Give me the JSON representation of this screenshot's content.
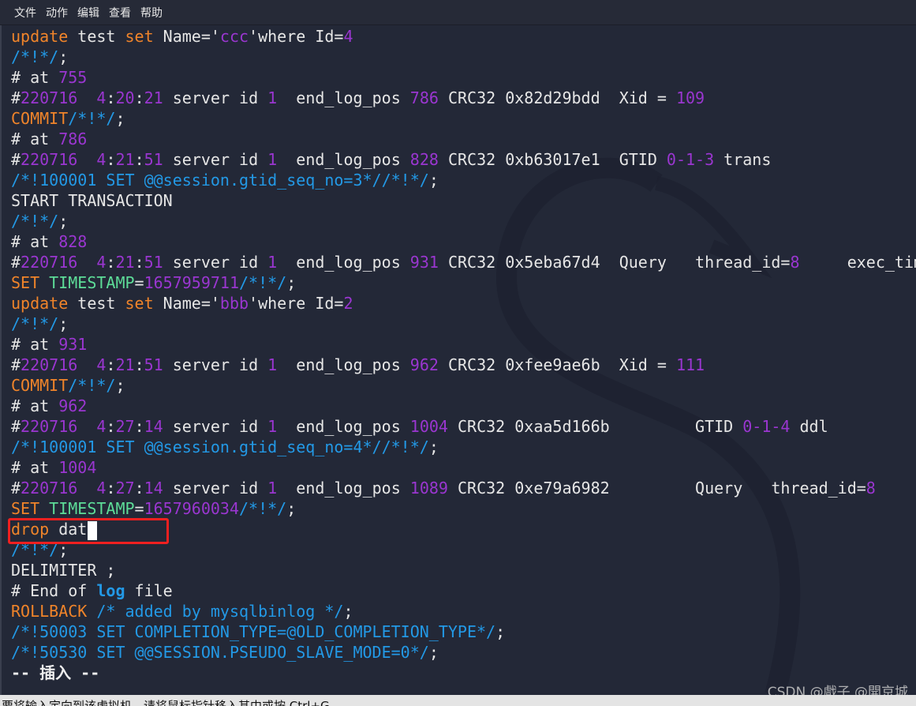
{
  "menu": [
    "文件",
    "动作",
    "编辑",
    "查看",
    "帮助"
  ],
  "colors": {
    "background": "#232837",
    "text": "#e6e6e6",
    "keyword": "#f0842a",
    "number": "#9a36d0",
    "comment": "#2399e6",
    "identifier": "#5ddc98",
    "highlight_box": "#f02020"
  },
  "terminal": {
    "lines": [
      [
        [
          "update",
          "o"
        ],
        [
          " test ",
          "w"
        ],
        [
          "set",
          "o"
        ],
        [
          " Name='",
          "w"
        ],
        [
          "ccc",
          "p"
        ],
        [
          "'where Id=",
          "w"
        ],
        [
          "4",
          "p"
        ]
      ],
      [
        [
          "/*!*/",
          "b"
        ],
        [
          ";",
          "w"
        ]
      ],
      [
        [
          "# at ",
          "w"
        ],
        [
          "755",
          "p"
        ]
      ],
      [
        [
          "#",
          "w"
        ],
        [
          "220716",
          "p"
        ],
        [
          "  ",
          "w"
        ],
        [
          "4",
          "p"
        ],
        [
          ":",
          "w"
        ],
        [
          "20",
          "p"
        ],
        [
          ":",
          "w"
        ],
        [
          "21",
          "p"
        ],
        [
          " server id ",
          "w"
        ],
        [
          "1",
          "p"
        ],
        [
          "  end_log_pos ",
          "w"
        ],
        [
          "786",
          "p"
        ],
        [
          " CRC32 0x82d29bdd  Xid = ",
          "w"
        ],
        [
          "109",
          "p"
        ]
      ],
      [
        [
          "COMMIT",
          "o"
        ],
        [
          "/*!*/",
          "b"
        ],
        [
          ";",
          "w"
        ]
      ],
      [
        [
          "# at ",
          "w"
        ],
        [
          "786",
          "p"
        ]
      ],
      [
        [
          "#",
          "w"
        ],
        [
          "220716",
          "p"
        ],
        [
          "  ",
          "w"
        ],
        [
          "4",
          "p"
        ],
        [
          ":",
          "w"
        ],
        [
          "21",
          "p"
        ],
        [
          ":",
          "w"
        ],
        [
          "51",
          "p"
        ],
        [
          " server id ",
          "w"
        ],
        [
          "1",
          "p"
        ],
        [
          "  end_log_pos ",
          "w"
        ],
        [
          "828",
          "p"
        ],
        [
          " CRC32 0xb63017e1  GTID ",
          "w"
        ],
        [
          "0-1-3",
          "p"
        ],
        [
          " trans",
          "w"
        ]
      ],
      [
        [
          "/*!100001 SET @@session.gtid_seq_no=3*//*!*/",
          "b"
        ],
        [
          ";",
          "w"
        ]
      ],
      [
        [
          "START TRANSACTION",
          "w"
        ]
      ],
      [
        [
          "/*!*/",
          "b"
        ],
        [
          ";",
          "w"
        ]
      ],
      [
        [
          "# at ",
          "w"
        ],
        [
          "828",
          "p"
        ]
      ],
      [
        [
          "#",
          "w"
        ],
        [
          "220716",
          "p"
        ],
        [
          "  ",
          "w"
        ],
        [
          "4",
          "p"
        ],
        [
          ":",
          "w"
        ],
        [
          "21",
          "p"
        ],
        [
          ":",
          "w"
        ],
        [
          "51",
          "p"
        ],
        [
          " server id ",
          "w"
        ],
        [
          "1",
          "p"
        ],
        [
          "  end_log_pos ",
          "w"
        ],
        [
          "931",
          "p"
        ],
        [
          " CRC32 0x5eba67d4  Query   thread_id=",
          "w"
        ],
        [
          "8",
          "p"
        ],
        [
          "     exec_time",
          "w"
        ]
      ],
      [
        [
          "SET ",
          "o"
        ],
        [
          "TIMESTAMP",
          "g"
        ],
        [
          "=",
          "w"
        ],
        [
          "1657959711",
          "p"
        ],
        [
          "/*!*/",
          "b"
        ],
        [
          ";",
          "w"
        ]
      ],
      [
        [
          "update",
          "o"
        ],
        [
          " test ",
          "w"
        ],
        [
          "set",
          "o"
        ],
        [
          " Name='",
          "w"
        ],
        [
          "bbb",
          "p"
        ],
        [
          "'where Id=",
          "w"
        ],
        [
          "2",
          "p"
        ]
      ],
      [
        [
          "/*!*/",
          "b"
        ],
        [
          ";",
          "w"
        ]
      ],
      [
        [
          "# at ",
          "w"
        ],
        [
          "931",
          "p"
        ]
      ],
      [
        [
          "#",
          "w"
        ],
        [
          "220716",
          "p"
        ],
        [
          "  ",
          "w"
        ],
        [
          "4",
          "p"
        ],
        [
          ":",
          "w"
        ],
        [
          "21",
          "p"
        ],
        [
          ":",
          "w"
        ],
        [
          "51",
          "p"
        ],
        [
          " server id ",
          "w"
        ],
        [
          "1",
          "p"
        ],
        [
          "  end_log_pos ",
          "w"
        ],
        [
          "962",
          "p"
        ],
        [
          " CRC32 0xfee9ae6b  Xid = ",
          "w"
        ],
        [
          "111",
          "p"
        ]
      ],
      [
        [
          "COMMIT",
          "o"
        ],
        [
          "/*!*/",
          "b"
        ],
        [
          ";",
          "w"
        ]
      ],
      [
        [
          "# at ",
          "w"
        ],
        [
          "962",
          "p"
        ]
      ],
      [
        [
          "#",
          "w"
        ],
        [
          "220716",
          "p"
        ],
        [
          "  ",
          "w"
        ],
        [
          "4",
          "p"
        ],
        [
          ":",
          "w"
        ],
        [
          "27",
          "p"
        ],
        [
          ":",
          "w"
        ],
        [
          "14",
          "p"
        ],
        [
          " server id ",
          "w"
        ],
        [
          "1",
          "p"
        ],
        [
          "  end_log_pos ",
          "w"
        ],
        [
          "1004",
          "p"
        ],
        [
          " CRC32 0xaa5d166b         GTID ",
          "w"
        ],
        [
          "0-1-4",
          "p"
        ],
        [
          " ddl",
          "w"
        ]
      ],
      [
        [
          "/*!100001 SET @@session.gtid_seq_no=4*//*!*/",
          "b"
        ],
        [
          ";",
          "w"
        ]
      ],
      [
        [
          "# at ",
          "w"
        ],
        [
          "1004",
          "p"
        ]
      ],
      [
        [
          "#",
          "w"
        ],
        [
          "220716",
          "p"
        ],
        [
          "  ",
          "w"
        ],
        [
          "4",
          "p"
        ],
        [
          ":",
          "w"
        ],
        [
          "27",
          "p"
        ],
        [
          ":",
          "w"
        ],
        [
          "14",
          "p"
        ],
        [
          " server id ",
          "w"
        ],
        [
          "1",
          "p"
        ],
        [
          "  end_log_pos ",
          "w"
        ],
        [
          "1089",
          "p"
        ],
        [
          " CRC32 0xe79a6982         Query   thread_id=",
          "w"
        ],
        [
          "8",
          "p"
        ]
      ],
      [
        [
          "SET ",
          "o"
        ],
        [
          "TIMESTAMP",
          "g"
        ],
        [
          "=",
          "w"
        ],
        [
          "1657960034",
          "p"
        ],
        [
          "/*!*/",
          "b"
        ],
        [
          ";",
          "w"
        ]
      ],
      [
        [
          "drop",
          "o"
        ],
        [
          " dat",
          "w"
        ]
      ],
      [
        [
          "/*!*/",
          "b"
        ],
        [
          ";",
          "w"
        ]
      ],
      [
        [
          "DELIMITER ;",
          "w"
        ]
      ],
      [
        [
          "# End of ",
          "w"
        ],
        [
          "log",
          "bb"
        ],
        [
          " file",
          "w"
        ]
      ],
      [
        [
          "ROLLBACK",
          "o"
        ],
        [
          " /* added by mysqlbinlog */",
          "b"
        ],
        [
          ";",
          "w"
        ]
      ],
      [
        [
          "/*!50003 SET COMPLETION_TYPE=@OLD_COMPLETION_TYPE*/",
          "b"
        ],
        [
          ";",
          "w"
        ]
      ],
      [
        [
          "/*!50530 SET @@SESSION.PSEUDO_SLAVE_MODE=0*/",
          "b"
        ],
        [
          ";",
          "w"
        ]
      ],
      [
        [
          "-- 插入 --",
          "wb"
        ]
      ]
    ]
  },
  "status_bar": {
    "text": "要将输入定向到该虚拟机，请将鼠标指针移入其中或按 Ctrl+G。"
  },
  "watermark": "CSDN @戲子  @開京城"
}
